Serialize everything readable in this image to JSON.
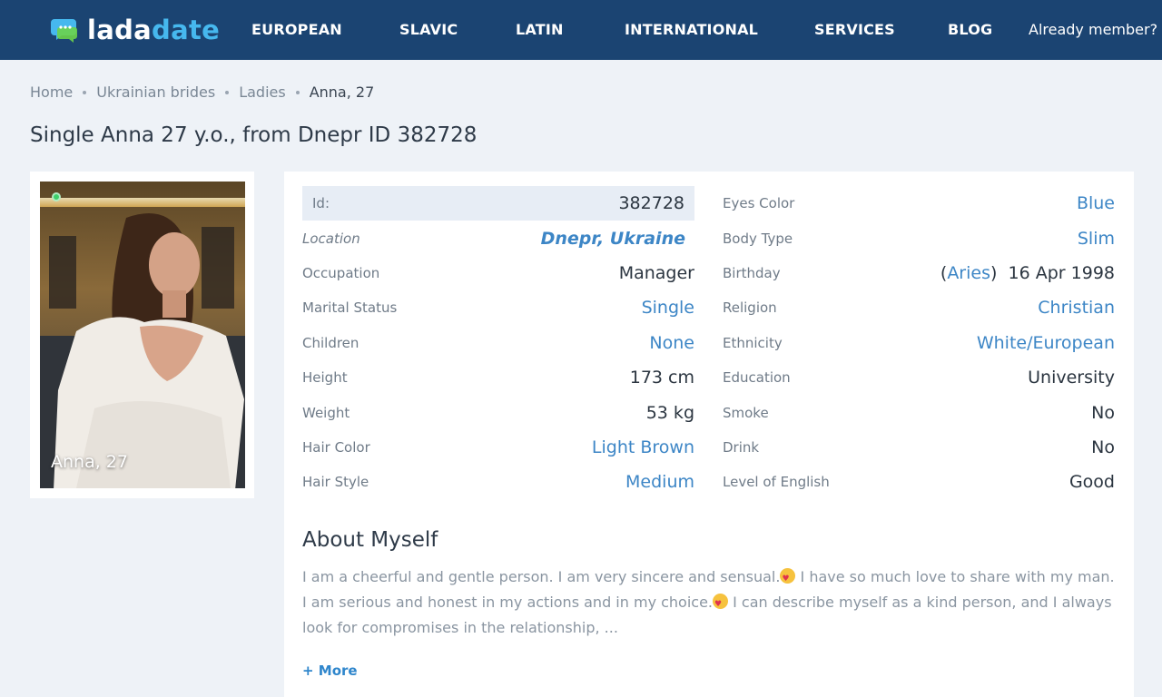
{
  "brand": {
    "part1": "lada",
    "part2": "date"
  },
  "nav": {
    "items": [
      "EUROPEAN",
      "SLAVIC",
      "LATIN",
      "INTERNATIONAL",
      "SERVICES",
      "BLOG"
    ],
    "member": "Already member?"
  },
  "breadcrumb": [
    "Home",
    "Ukrainian brides",
    "Ladies",
    "Anna, 27"
  ],
  "page_title": "Single Anna 27 y.o., from Dnepr ID 382728",
  "photo": {
    "caption": "Anna, 27",
    "online": true
  },
  "profile": {
    "left": [
      {
        "label": "Id:",
        "value": "382728"
      },
      {
        "label": "Location",
        "value": "Dnepr, Ukraine"
      },
      {
        "label": "Occupation",
        "value": "Manager"
      },
      {
        "label": "Marital Status",
        "value": "Single"
      },
      {
        "label": "Children",
        "value": "None"
      },
      {
        "label": "Height",
        "value": "173 cm"
      },
      {
        "label": "Weight",
        "value": "53 kg"
      },
      {
        "label": "Hair Color",
        "value": "Light Brown"
      },
      {
        "label": "Hair Style",
        "value": "Medium"
      }
    ],
    "right": [
      {
        "label": "Eyes Color",
        "value": "Blue"
      },
      {
        "label": "Body Type",
        "value": "Slim"
      },
      {
        "label": "Birthday",
        "zodiac": "Aries",
        "value": "16 Apr 1998"
      },
      {
        "label": "Religion",
        "value": "Christian"
      },
      {
        "label": "Ethnicity",
        "value": "White/European"
      },
      {
        "label": "Education",
        "value": "University"
      },
      {
        "label": "Smoke",
        "value": "No"
      },
      {
        "label": "Drink",
        "value": "No"
      },
      {
        "label": "Level of English",
        "value": "Good"
      }
    ]
  },
  "about": {
    "title": "About Myself",
    "text1": "I am a cheerful and gentle person. I am very sincere and sensual.",
    "text2": " I have so much love to share with my man. I am serious and honest in my actions and in my choice.",
    "text3": " I can describe myself as a kind person, and I always look for compromises in the relationship, ...",
    "more": "+ More"
  },
  "colors": {
    "header": "#1b4472",
    "accent": "#46b8ee",
    "link": "#3d86c6"
  }
}
